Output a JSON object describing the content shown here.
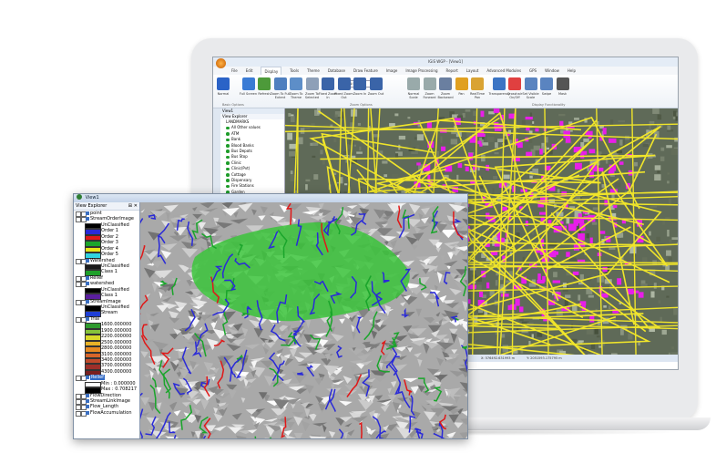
{
  "back_app": {
    "window_title": "IGiS WGP - [View1]",
    "tabs": [
      "File",
      "Edit",
      "Display",
      "Tools",
      "Theme",
      "Database",
      "Draw Feature",
      "Image",
      "Image Processing",
      "Report",
      "Layout",
      "Advanced Modules",
      "GPS",
      "Window",
      "Help"
    ],
    "active_tab": "Display",
    "ribbon": {
      "buttons": [
        "Normal",
        "Full Screen",
        "Refresh",
        "Zoom To Full Extent",
        "Zoom To Theme",
        "Zoom To Selected",
        "Fixed Zoom In",
        "Fixed Zoom Out",
        "Zoom In",
        "Zoom Out",
        "Normal Scale",
        "Zoom Forward",
        "Zoom Backward",
        "Pan",
        "RealTime Pan",
        "Transparency",
        "Crosshair On/Off",
        "Set Visible Scale",
        "Swipe",
        "Mask",
        "Find By Location",
        "Link Views",
        "Unlink",
        "Zoom To Bookmark",
        "Bookmark",
        "Dynamic Threshold"
      ],
      "scale_value": "1:5963",
      "groups": [
        "Basic Options",
        "Zoom Options",
        "Display Functionality"
      ]
    },
    "side_tab": "Property Explorer",
    "view_tab": "View1",
    "explorer": {
      "header": "View Explorer",
      "root": "LANDMARKS",
      "items": [
        "All Other values",
        "ATM",
        "Bank",
        "Blood Banks",
        "Bus Depots",
        "Bus Stop",
        "Clinic",
        "Clinic(Pvt)",
        "Cottage",
        "Dispensary",
        "Fire Stations",
        "Garden",
        "Government Office",
        "Hospitals"
      ]
    },
    "status_coords": [
      "X: 576492.631993 m",
      "Y: 2051593.175795 m"
    ]
  },
  "front_window": {
    "title": "View1",
    "explorer_header": "View Explorer",
    "close_glyph": "✕",
    "pin_glyph": "⊞",
    "tree": [
      {
        "kind": "layer",
        "label": "point"
      },
      {
        "kind": "layer",
        "label": "StreamOrderImage"
      },
      {
        "kind": "legend",
        "label": "UnClassified",
        "color": "#000000"
      },
      {
        "kind": "legend",
        "label": "Order 1",
        "color": "#2a2ad8"
      },
      {
        "kind": "legend",
        "label": "Order 2",
        "color": "#e01818"
      },
      {
        "kind": "legend",
        "label": "Order 3",
        "color": "#1aa52b"
      },
      {
        "kind": "legend",
        "label": "Order 4",
        "color": "#e6e617"
      },
      {
        "kind": "legend",
        "label": "Order 5",
        "color": "#2fd3e0"
      },
      {
        "kind": "layer",
        "label": "Watershed"
      },
      {
        "kind": "legend",
        "label": "UnClassified",
        "color": "#1c1c1c"
      },
      {
        "kind": "legend",
        "label": "Class 1",
        "color": "#1fa02a"
      },
      {
        "kind": "layer",
        "label": "Relief"
      },
      {
        "kind": "layer",
        "label": "watershed"
      },
      {
        "kind": "legend",
        "label": "UnClassified",
        "color": "#000000"
      },
      {
        "kind": "legend",
        "label": "Class 1",
        "color": "#5a1e9e"
      },
      {
        "kind": "layer",
        "label": "StreamImage"
      },
      {
        "kind": "legend",
        "label": "UnClassified",
        "color": "#000000"
      },
      {
        "kind": "legend",
        "label": "Stream",
        "color": "#1f3fd6"
      },
      {
        "kind": "layer",
        "label": "Trial"
      },
      {
        "kind": "legend",
        "label": "1600.000000",
        "color": "#2f9a2f"
      },
      {
        "kind": "legend",
        "label": "1900.000000",
        "color": "#86c23a"
      },
      {
        "kind": "legend",
        "label": "2200.000000",
        "color": "#d9d92a"
      },
      {
        "kind": "legend",
        "label": "2500.000000",
        "color": "#e8b227"
      },
      {
        "kind": "legend",
        "label": "2800.000000",
        "color": "#e78a22"
      },
      {
        "kind": "legend",
        "label": "3100.000000",
        "color": "#d7652a"
      },
      {
        "kind": "legend",
        "label": "3400.000000",
        "color": "#c04a2b"
      },
      {
        "kind": "legend",
        "label": "3700.000000",
        "color": "#9e2f2a"
      },
      {
        "kind": "legend",
        "label": "4300.000000",
        "color": "#7a1f1e"
      },
      {
        "kind": "layer",
        "label": "Relief",
        "selected": true
      },
      {
        "kind": "legend",
        "label": "Min : 0.000000",
        "color": "#ffffff"
      },
      {
        "kind": "legend",
        "label": "Max : 0.708217",
        "color": "#000000"
      },
      {
        "kind": "layer",
        "label": "FlowDirection"
      },
      {
        "kind": "layer",
        "label": "StreamLinkImage"
      },
      {
        "kind": "layer",
        "label": "Flow_Length"
      },
      {
        "kind": "layer",
        "label": "FlowAccumulation"
      }
    ]
  },
  "colors": {
    "stream_order1": "#2a2ad8",
    "stream_order2": "#e01818",
    "stream_order3": "#1aa52b",
    "watershed": "#3bc43b",
    "road": "#f0e52a",
    "building": "#e81ee8"
  }
}
